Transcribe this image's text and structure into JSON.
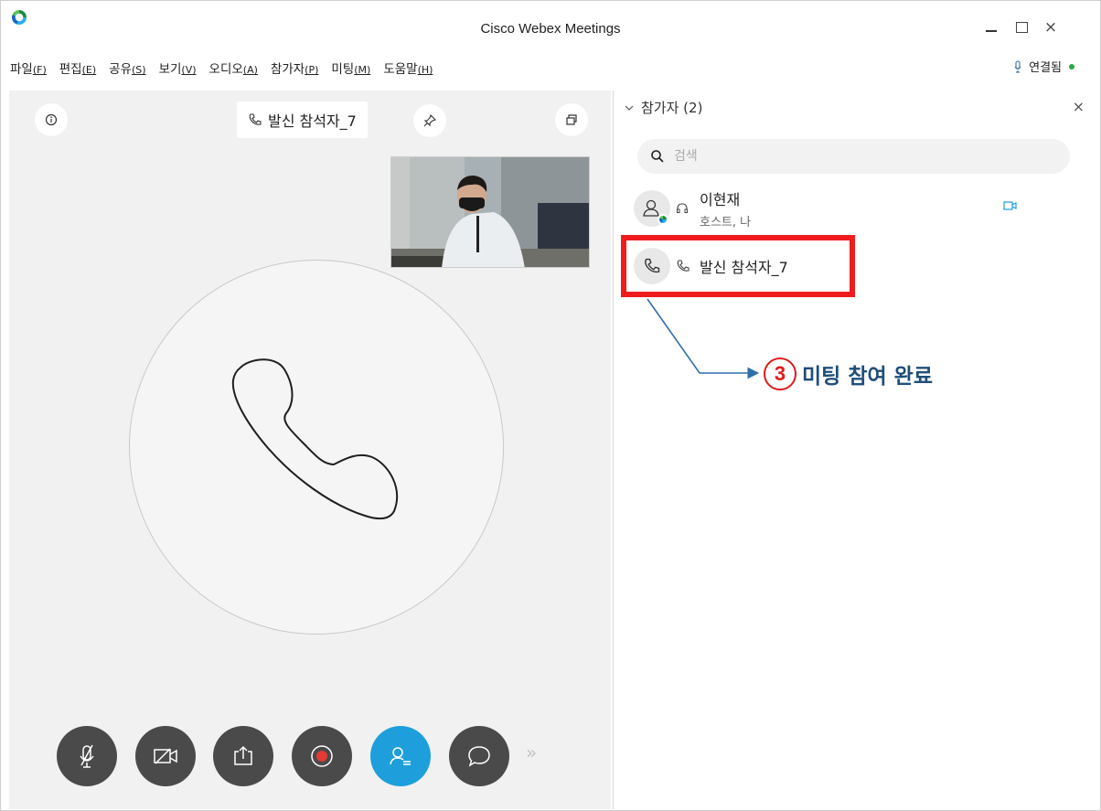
{
  "window": {
    "title": "Cisco Webex Meetings",
    "close_glyph": "×"
  },
  "menu": {
    "items": [
      {
        "label": "파일",
        "key": "(F)"
      },
      {
        "label": "편집",
        "key": "(E)"
      },
      {
        "label": "공유",
        "key": "(S)"
      },
      {
        "label": "보기",
        "key": "(V)"
      },
      {
        "label": "오디오",
        "key": "(A)"
      },
      {
        "label": "참가자",
        "key": "(P)"
      },
      {
        "label": "미팅",
        "key": "(M)"
      },
      {
        "label": "도움말",
        "key": "(H)"
      }
    ]
  },
  "connection": {
    "status": "연결됨",
    "status_color": "#2da845"
  },
  "stage": {
    "active_speaker": "발신 참석자_7"
  },
  "controls": {
    "buttons": [
      {
        "name": "mute-button",
        "icon": "mic-off-icon"
      },
      {
        "name": "video-button",
        "icon": "video-off-icon"
      },
      {
        "name": "share-button",
        "icon": "share-icon"
      },
      {
        "name": "record-button",
        "icon": "record-icon"
      },
      {
        "name": "participants-button",
        "icon": "participants-icon",
        "active": true
      },
      {
        "name": "chat-button",
        "icon": "chat-icon"
      }
    ],
    "active_color": "#1e9fdc",
    "default_color": "#4a4a4a"
  },
  "panel": {
    "title": "참가자 (2)",
    "close_glyph": "×",
    "search_placeholder": "검색",
    "participants": [
      {
        "name": "이현재",
        "role": "호스트, 나"
      },
      {
        "name": "발신 참석자_7",
        "role": ""
      }
    ]
  },
  "annotation": {
    "number": "3",
    "text": "미팅 참여 완료",
    "box_color": "#ee1c1c",
    "text_color": "#1f4e79"
  }
}
